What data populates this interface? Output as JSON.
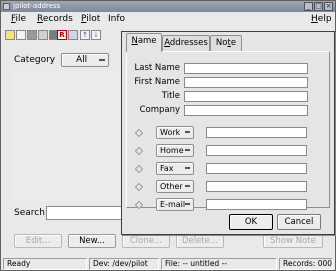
{
  "window": {
    "title": "jpilot-address"
  },
  "menubar": {
    "file": {
      "first": "F",
      "rest": "ile"
    },
    "records": {
      "first": "R",
      "rest": "ecords"
    },
    "pilot": {
      "first": "P",
      "rest": "ilot"
    },
    "info": "Info",
    "help": {
      "first": "H",
      "rest": "elp"
    }
  },
  "left": {
    "category_label": "Category",
    "category_value": "All",
    "search_label": "Search:",
    "search_value": "",
    "buttons": {
      "edit": "Edit...",
      "new": "New...",
      "clone": "Clone...",
      "delete": "Delete...",
      "show_note": "Show Note"
    }
  },
  "dialog": {
    "tabs": [
      {
        "label": "Name",
        "underline": "N",
        "rest": "ame"
      },
      {
        "label": "Addresses",
        "underline": "A",
        "rest": "ddresses"
      },
      {
        "label": "Note",
        "pre": "No",
        "underline": "t",
        "rest": "e"
      }
    ],
    "fields": {
      "last_name": {
        "label": "Last Name",
        "value": ""
      },
      "first_name": {
        "label": "First Name",
        "value": ""
      },
      "title": {
        "label": "Title",
        "value": ""
      },
      "company": {
        "label": "Company",
        "value": ""
      }
    },
    "phones": [
      {
        "type": "Work",
        "value": ""
      },
      {
        "type": "Home",
        "value": ""
      },
      {
        "type": "Fax",
        "value": ""
      },
      {
        "type": "Other",
        "value": ""
      },
      {
        "type": "E-mail",
        "value": ""
      }
    ],
    "ok": "OK",
    "cancel": "Cancel"
  },
  "statusbar": {
    "status": "Ready",
    "device": "Dev: /dev/pilot",
    "file": "File: -- untitled --",
    "records": "Records: 000"
  },
  "colors": {
    "titlebar": "#8a93a3",
    "window": "#e9e9e9",
    "dialog": "#e5e5e5"
  },
  "icons": [
    "new-doc-icon",
    "save-icon",
    "record-icon",
    "folder-icon",
    "r-icon",
    "hotsync-icon",
    "up-arrow-icon",
    "down-arrow-icon"
  ]
}
